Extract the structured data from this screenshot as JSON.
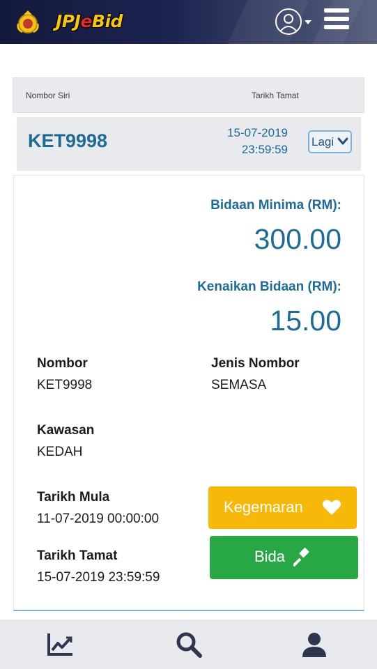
{
  "header": {
    "logo_prefix": "JPJ",
    "logo_e": "e",
    "logo_suffix": "Bid",
    "icons": [
      "jpj-emblem-icon",
      "user-icon",
      "menu-icon"
    ]
  },
  "table": {
    "col_serial": "Nombor Siri",
    "col_end_date": "Tarikh Tamat",
    "row": {
      "plate": "KET9998",
      "end_date": "15-07-2019",
      "end_time": "23:59:59",
      "more_label": "Lagi"
    }
  },
  "detail": {
    "min_bid_label": "Bidaan Minima (RM):",
    "min_bid_value": "300.00",
    "increment_label": "Kenaikan Bidaan (RM):",
    "increment_value": "15.00",
    "number_label": "Nombor",
    "number_value": "KET9998",
    "type_label": "Jenis Nombor",
    "type_value": "SEMASA",
    "region_label": "Kawasan",
    "region_value": "KEDAH",
    "start_label": "Tarikh Mula",
    "start_value": "11-07-2019 00:00:00",
    "end_label": "Tarikh Tamat",
    "end_value": "15-07-2019 23:59:59",
    "favorite_label": "Kegemaran",
    "bid_label": "Bida"
  },
  "bottom_nav": {
    "icons": [
      "chart-icon",
      "search-icon",
      "profile-icon"
    ]
  },
  "colors": {
    "accent": "#1f6b94",
    "favorite": "#f7b80a",
    "bid": "#28a745",
    "header_dark": "#141a3c"
  }
}
